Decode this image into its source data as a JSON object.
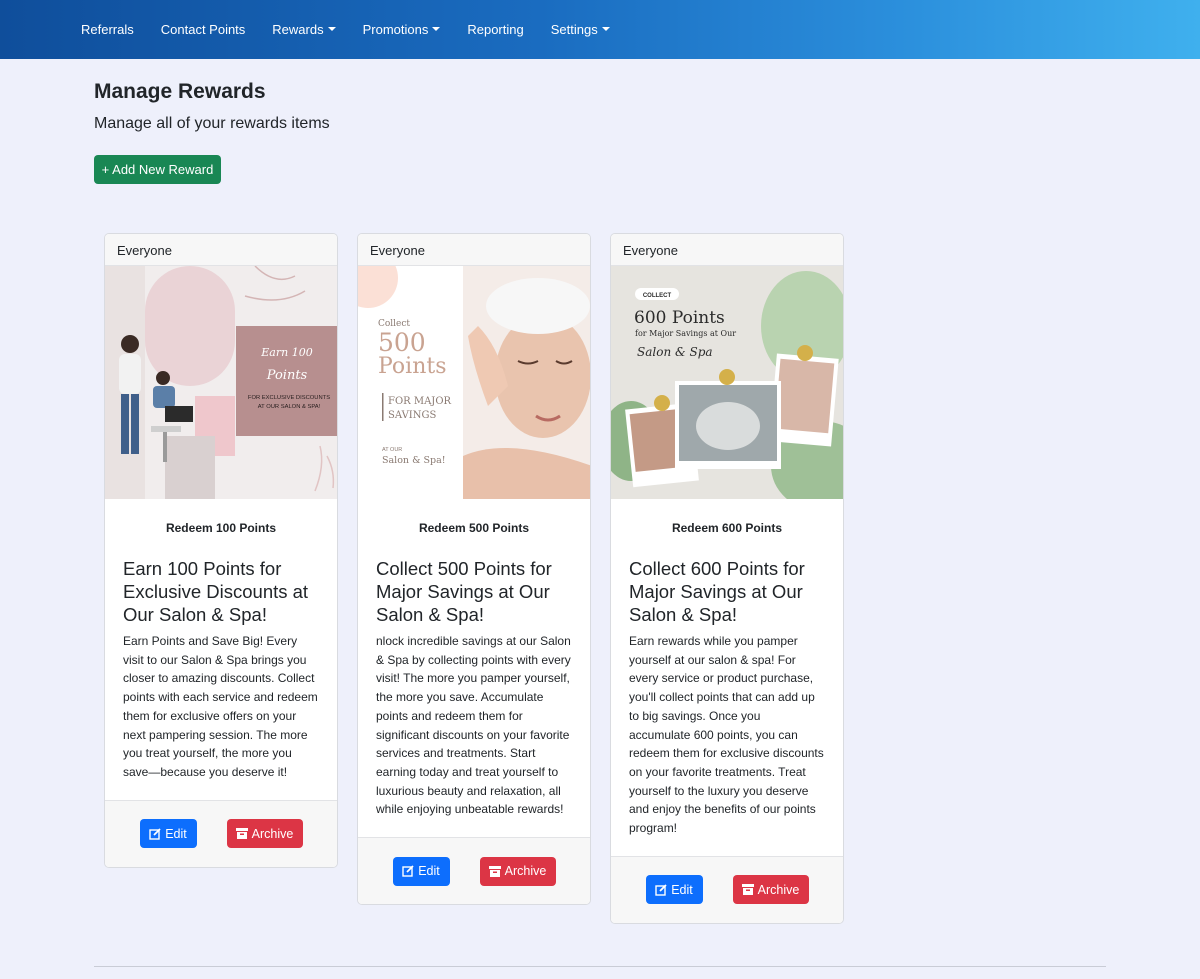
{
  "nav": {
    "items": [
      {
        "label": "Referrals",
        "dropdown": false
      },
      {
        "label": "Contact Points",
        "dropdown": false
      },
      {
        "label": "Rewards",
        "dropdown": true
      },
      {
        "label": "Promotions",
        "dropdown": true
      },
      {
        "label": "Reporting",
        "dropdown": false
      },
      {
        "label": "Settings",
        "dropdown": true
      }
    ]
  },
  "header": {
    "title": "Manage Rewards",
    "subtitle": "Manage all of your rewards items",
    "add_button": "+ Add New Reward"
  },
  "cards": [
    {
      "audience": "Everyone",
      "redeem": "Redeem 100 Points",
      "title": "Earn 100 Points for Exclusive Discounts at Our Salon & Spa!",
      "description": "Earn Points and Save Big! Every visit to our Salon & Spa brings you closer to amazing discounts. Collect points with each service and redeem them for exclusive offers on your next pampering session. The more you treat yourself, the more you save—because you deserve it!",
      "image": {
        "line1": "Earn 100",
        "line2": "Points",
        "line3": "FOR EXCLUSIVE DISCOUNTS",
        "line4": "AT OUR SALON & SPA!"
      },
      "edit_label": "Edit",
      "archive_label": "Archive"
    },
    {
      "audience": "Everyone",
      "redeem": "Redeem 500 Points",
      "title": "Collect 500 Points for Major Savings at Our Salon & Spa!",
      "description": "nlock incredible savings at our Salon & Spa by collecting points with every visit! The more you pamper yourself, the more you save. Accumulate points and redeem them for significant discounts on your favorite services and treatments. Start earning today and treat yourself to luxurious beauty and relaxation, all while enjoying unbeatable rewards!",
      "image": {
        "line1": "Collect",
        "line2": "500",
        "line3": "Points",
        "line4": "FOR MAJOR",
        "line5": "SAVINGS",
        "line6": "AT OUR",
        "line7": "Salon & Spa!"
      },
      "edit_label": "Edit",
      "archive_label": "Archive"
    },
    {
      "audience": "Everyone",
      "redeem": "Redeem 600 Points",
      "title": "Collect 600 Points for Major Savings at Our Salon & Spa!",
      "description": "Earn rewards while you pamper yourself at our salon & spa! For every service or product purchase, you'll collect points that can add up to big savings. Once you accumulate 600 points, you can redeem them for exclusive discounts on your favorite treatments. Treat yourself to the luxury you deserve and enjoy the benefits of our points program!",
      "image": {
        "badge": "COLLECT",
        "line1": "600 Points",
        "line2": "for Major Savings at Our",
        "line3": "Salon & Spa"
      },
      "edit_label": "Edit",
      "archive_label": "Archive"
    }
  ],
  "colors": {
    "nav_start": "#0f4e9b",
    "nav_end": "#3fb0ee",
    "success": "#198754",
    "primary": "#0d6efd",
    "danger": "#dc3545",
    "page_bg": "#eef0fb"
  }
}
